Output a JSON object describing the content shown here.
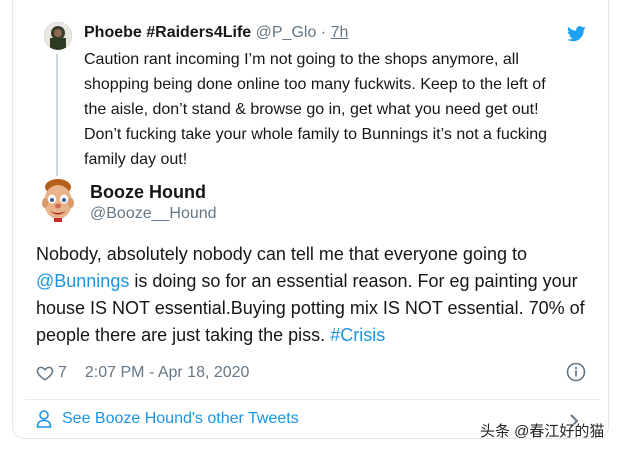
{
  "quoted_tweet": {
    "name": "Phoebe #Raiders4Life",
    "handle": "@P_Glo",
    "separator": " · ",
    "time": "7h",
    "text": "Caution rant incoming I’m not going to the shops anymore, all\nshopping being done online too many fuckwits. Keep to the left of\nthe aisle, don’t stand & browse go in, get what you need get out!\nDon’t fucking take your whole family to Bunnings it’s not a fucking\nfamily day out!"
  },
  "main_tweet": {
    "name": "Booze Hound",
    "handle": "@Booze__Hound",
    "text_1": "Nobody, absolutely nobody can tell me that everyone going to ",
    "mention": "@Bunnings",
    "text_2": " is doing so for an essential reason. For eg painting your house IS NOT essential.Buying potting mix IS NOT essential. 70% of people there are just taking the piss. ",
    "hashtag": "#Crisis",
    "likes": "7",
    "timestamp": "2:07 PM - Apr 18, 2020"
  },
  "footer": {
    "link_label": "See Booze Hound's other Tweets"
  },
  "watermark": "头条 @春江好的猫",
  "icons": {
    "brand": "twitter-bird-icon",
    "like": "heart-outline-icon",
    "info": "info-icon",
    "profile": "user-icon",
    "more": "chevron-right-icon"
  },
  "colors": {
    "twitter_blue": "#1da1f2",
    "link": "#1b95e0",
    "secondary_text": "#657786",
    "border": "#e1e8ed"
  }
}
